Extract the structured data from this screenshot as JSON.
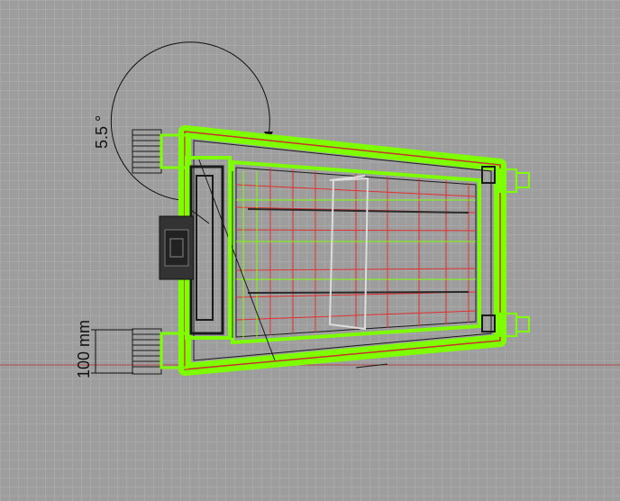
{
  "annotations": {
    "angle_label": "5.5 °",
    "width_label": "100 mm"
  },
  "colors": {
    "grid_minor": "#a8a8a8",
    "grid_major": "#8f8f8f",
    "background": "#9d9d9d",
    "axis": "#b84848",
    "wireframe_green": "#7dff00",
    "wireframe_red": "#e03030",
    "wireframe_dark": "#1a1a1a"
  }
}
